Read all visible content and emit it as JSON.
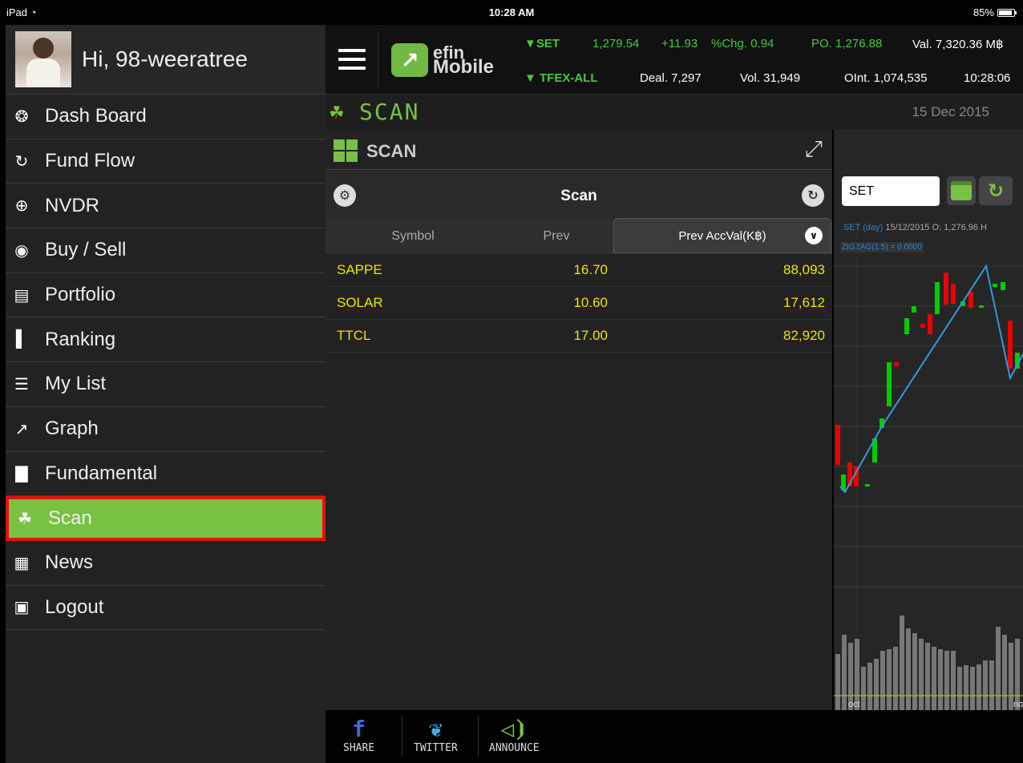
{
  "status": {
    "device": "iPad",
    "time": "10:28 AM",
    "battery": "85%"
  },
  "user": {
    "greeting": "Hi, 98-weeratree"
  },
  "menu": [
    {
      "label": "Dash Board",
      "icon": "dashboard-icon"
    },
    {
      "label": "Fund Flow",
      "icon": "fund-flow-icon"
    },
    {
      "label": "NVDR",
      "icon": "globe-icon"
    },
    {
      "label": "Buy / Sell",
      "icon": "coin-icon"
    },
    {
      "label": "Portfolio",
      "icon": "portfolio-icon"
    },
    {
      "label": "Ranking",
      "icon": "ranking-icon"
    },
    {
      "label": "My List",
      "icon": "list-icon"
    },
    {
      "label": "Graph",
      "icon": "graph-icon"
    },
    {
      "label": "Fundamental",
      "icon": "fundamental-icon"
    },
    {
      "label": "Scan",
      "icon": "scan-icon",
      "active": true
    },
    {
      "label": "News",
      "icon": "news-icon"
    },
    {
      "label": "Logout",
      "icon": "lock-icon"
    }
  ],
  "logo": {
    "line1": "efin",
    "line2": "Mobile"
  },
  "ticker": {
    "set_name": "SET",
    "set_value": "1,279.54",
    "set_change": "+11.93",
    "set_pct": "%Chg. 0.94",
    "set_po": "PO. 1,276.88",
    "set_val": "Val. 7,320.36 M฿",
    "tfex_name": "TFEX-ALL",
    "tfex_deal": "Deal. 7,297",
    "tfex_vol": "Vol. 31,949",
    "tfex_oint": "OInt. 1,074,535",
    "tfex_time": "10:28:06"
  },
  "scan": {
    "title": "SCAN",
    "date": "15 Dec 2015",
    "panel_label": "SCAN",
    "toolbar_title": "Scan"
  },
  "table": {
    "columns": {
      "symbol": "Symbol",
      "prev": "Prev",
      "acc": "Prev AccVal(K฿)"
    },
    "rows": [
      {
        "symbol": "SAPPE",
        "prev": "16.70",
        "acc": "88,093"
      },
      {
        "symbol": "SOLAR",
        "prev": "10.60",
        "acc": "17,612"
      },
      {
        "symbol": "TTCL",
        "prev": "17.00",
        "acc": "82,920"
      }
    ]
  },
  "chart": {
    "symbol_input": "SET",
    "label_series": "SET (day)",
    "label_ohlc": "15/12/2015 O: 1,276.96 H",
    "indicator": "ZIGZAG(1.5) = 0.0000",
    "x_label_1": "oct",
    "x_label_2": "no"
  },
  "footer": {
    "share": "SHARE",
    "twitter": "TWITTER",
    "announce": "ANNOUNCE"
  },
  "colors": {
    "accent": "#79c142",
    "highlight_border": "#e51010",
    "value_yellow": "#e8e800",
    "ticker_green": "#45c93b"
  }
}
